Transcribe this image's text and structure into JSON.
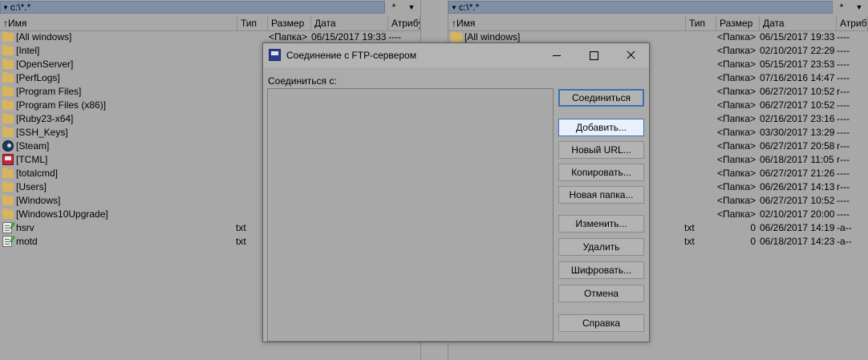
{
  "left_panel": {
    "path": "c:\\*.*",
    "filter": "*",
    "headers": {
      "name": "Имя",
      "ext": "Тип",
      "size": "Размер",
      "date": "Дата",
      "attr": "Атрибу"
    },
    "rows": [
      {
        "icon": "folder-icon",
        "name": "[All windows]",
        "ext": "",
        "size": "<Папка>",
        "date": "06/15/2017 19:33",
        "attr": "----"
      },
      {
        "icon": "folder-icon",
        "name": "[Intel]",
        "ext": "",
        "size": "",
        "date": "",
        "attr": ""
      },
      {
        "icon": "folder-icon",
        "name": "[OpenServer]",
        "ext": "",
        "size": "",
        "date": "",
        "attr": ""
      },
      {
        "icon": "folder-icon",
        "name": "[PerfLogs]",
        "ext": "",
        "size": "",
        "date": "",
        "attr": ""
      },
      {
        "icon": "folder-icon",
        "name": "[Program Files]",
        "ext": "",
        "size": "",
        "date": "",
        "attr": ""
      },
      {
        "icon": "folder-icon",
        "name": "[Program Files (x86)]",
        "ext": "",
        "size": "",
        "date": "",
        "attr": ""
      },
      {
        "icon": "folder-icon",
        "name": "[Ruby23-x64]",
        "ext": "",
        "size": "",
        "date": "",
        "attr": ""
      },
      {
        "icon": "folder-icon",
        "name": "[SSH_Keys]",
        "ext": "",
        "size": "",
        "date": "",
        "attr": ""
      },
      {
        "icon": "steam-icon",
        "name": "[Steam]",
        "ext": "",
        "size": "",
        "date": "",
        "attr": ""
      },
      {
        "icon": "tcml-icon",
        "name": "[TCML]",
        "ext": "",
        "size": "",
        "date": "",
        "attr": ""
      },
      {
        "icon": "folder-icon",
        "name": "[totalcmd]",
        "ext": "",
        "size": "",
        "date": "",
        "attr": ""
      },
      {
        "icon": "folder-icon",
        "name": "[Users]",
        "ext": "",
        "size": "",
        "date": "",
        "attr": ""
      },
      {
        "icon": "folder-icon",
        "name": "[Windows]",
        "ext": "",
        "size": "",
        "date": "",
        "attr": ""
      },
      {
        "icon": "folder-icon",
        "name": "[Windows10Upgrade]",
        "ext": "",
        "size": "",
        "date": "",
        "attr": ""
      },
      {
        "icon": "text-file-icon",
        "name": "hsrv",
        "ext": "txt",
        "size": "",
        "date": "",
        "attr": ""
      },
      {
        "icon": "text-file-icon",
        "name": "motd",
        "ext": "txt",
        "size": "",
        "date": "",
        "attr": ""
      }
    ]
  },
  "right_panel": {
    "path": "c:\\*.*",
    "filter": "*",
    "headers": {
      "name": "Имя",
      "ext": "Тип",
      "size": "Размер",
      "date": "Дата",
      "attr": "Атрибу"
    },
    "rows": [
      {
        "icon": "folder-icon",
        "name": "[All windows]",
        "ext": "",
        "size": "<Папка>",
        "date": "06/15/2017 19:33",
        "attr": "----"
      },
      {
        "icon": "",
        "name": "",
        "ext": "",
        "size": "<Папка>",
        "date": "02/10/2017 22:29",
        "attr": "----"
      },
      {
        "icon": "",
        "name": "",
        "ext": "",
        "size": "<Папка>",
        "date": "05/15/2017 23:53",
        "attr": "----"
      },
      {
        "icon": "",
        "name": "",
        "ext": "",
        "size": "<Папка>",
        "date": "07/16/2016 14:47",
        "attr": "----"
      },
      {
        "icon": "",
        "name": "",
        "ext": "",
        "size": "<Папка>",
        "date": "06/27/2017 10:52",
        "attr": "r---"
      },
      {
        "icon": "",
        "name": "",
        "ext": "",
        "size": "<Папка>",
        "date": "06/27/2017 10:52",
        "attr": "----"
      },
      {
        "icon": "",
        "name": "",
        "ext": "",
        "size": "<Папка>",
        "date": "02/16/2017 23:16",
        "attr": "----"
      },
      {
        "icon": "",
        "name": "",
        "ext": "",
        "size": "<Папка>",
        "date": "03/30/2017 13:29",
        "attr": "----"
      },
      {
        "icon": "",
        "name": "",
        "ext": "",
        "size": "<Папка>",
        "date": "06/27/2017 20:58",
        "attr": "r---"
      },
      {
        "icon": "",
        "name": "",
        "ext": "",
        "size": "<Папка>",
        "date": "06/18/2017 11:05",
        "attr": "r---"
      },
      {
        "icon": "",
        "name": "",
        "ext": "",
        "size": "<Папка>",
        "date": "06/27/2017 21:26",
        "attr": "----"
      },
      {
        "icon": "",
        "name": "",
        "ext": "",
        "size": "<Папка>",
        "date": "06/26/2017 14:13",
        "attr": "r---"
      },
      {
        "icon": "",
        "name": "",
        "ext": "",
        "size": "<Папка>",
        "date": "06/27/2017 10:52",
        "attr": "----"
      },
      {
        "icon": "",
        "name": "",
        "ext": "",
        "size": "<Папка>",
        "date": "02/10/2017 20:00",
        "attr": "----"
      },
      {
        "icon": "",
        "name": "",
        "ext": "txt",
        "size": "0",
        "date": "06/26/2017 14:19",
        "attr": "-a--"
      },
      {
        "icon": "",
        "name": "",
        "ext": "txt",
        "size": "0",
        "date": "06/18/2017 14:23",
        "attr": "-a--"
      }
    ]
  },
  "dialog": {
    "title": "Соединение с FTP-сервером",
    "connect_to_label": "Соединиться с:",
    "buttons": {
      "connect": "Соединиться",
      "add": "Добавить...",
      "new_url": "Новый URL...",
      "copy": "Копировать...",
      "new_folder": "Новая папка...",
      "edit": "Изменить...",
      "delete": "Удалить",
      "encrypt": "Шифровать...",
      "cancel": "Отмена",
      "help": "Справка"
    }
  },
  "colors": {
    "panel_bg": "#a8a8a8",
    "path_bar": "#7f8fa6",
    "folder": "#d8b45c",
    "dialog_bg": "#ababab",
    "accent": "#3f6fb5"
  }
}
